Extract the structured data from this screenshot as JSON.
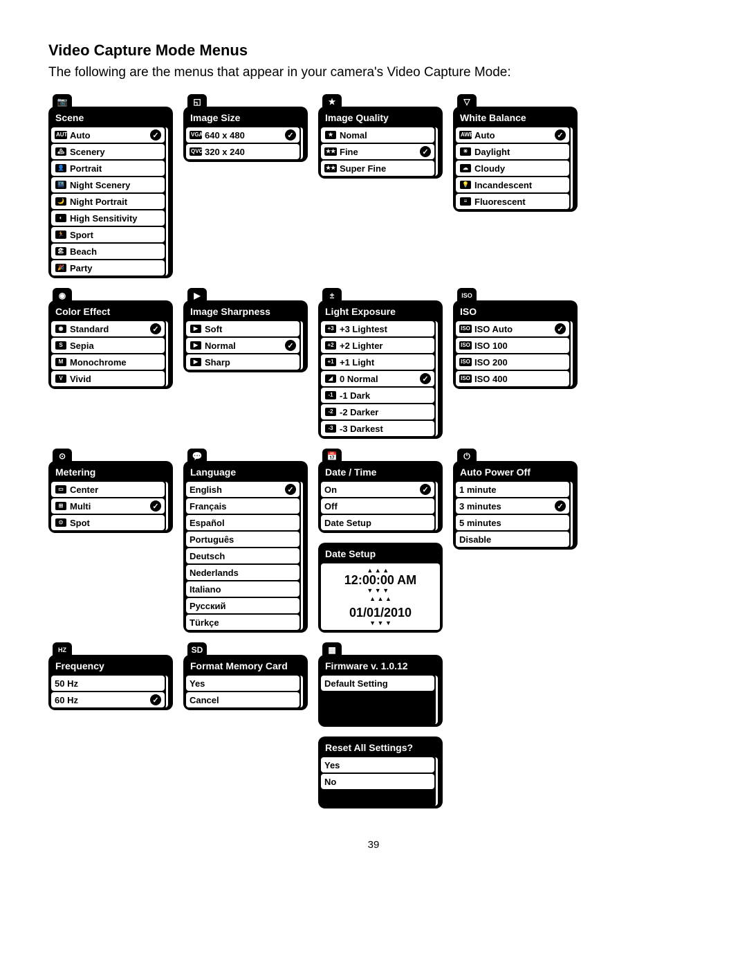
{
  "page_number": "39",
  "title": "Video Capture Mode Menus",
  "intro": "The following are the menus that appear in your camera's Video Capture Mode:",
  "menus": {
    "scene": {
      "title": "Scene",
      "items": [
        {
          "icon": "AUTO",
          "label": "Auto",
          "checked": true
        },
        {
          "icon": "🏔",
          "label": "Scenery"
        },
        {
          "icon": "👤",
          "label": "Portrait"
        },
        {
          "icon": "🌃",
          "label": "Night Scenery"
        },
        {
          "icon": "🌙",
          "label": "Night Portrait"
        },
        {
          "icon": "◐",
          "label": "High Sensitivity"
        },
        {
          "icon": "🏃",
          "label": "Sport"
        },
        {
          "icon": "🏖",
          "label": "Beach"
        },
        {
          "icon": "🎉",
          "label": "Party"
        }
      ]
    },
    "image_size": {
      "title": "Image Size",
      "items": [
        {
          "icon": "VGA",
          "label": "640 x 480",
          "checked": true
        },
        {
          "icon": "QVGA",
          "label": "320 x 240"
        }
      ]
    },
    "image_quality": {
      "title": "Image Quality",
      "items": [
        {
          "icon": "★",
          "label": "Nomal"
        },
        {
          "icon": "★★",
          "label": "Fine",
          "checked": true
        },
        {
          "icon": "★★",
          "label": "Super Fine"
        }
      ]
    },
    "white_balance": {
      "title": "White Balance",
      "items": [
        {
          "icon": "AWB",
          "label": "Auto",
          "checked": true
        },
        {
          "icon": "☀",
          "label": "Daylight"
        },
        {
          "icon": "☁",
          "label": "Cloudy"
        },
        {
          "icon": "💡",
          "label": "Incandescent"
        },
        {
          "icon": "≡",
          "label": "Fluorescent"
        }
      ]
    },
    "color_effect": {
      "title": "Color Effect",
      "items": [
        {
          "icon": "◉",
          "label": "Standard",
          "checked": true
        },
        {
          "icon": "S",
          "label": "Sepia"
        },
        {
          "icon": "M",
          "label": "Monochrome"
        },
        {
          "icon": "V",
          "label": "Vivid"
        }
      ]
    },
    "image_sharpness": {
      "title": "Image Sharpness",
      "items": [
        {
          "icon": "▶",
          "label": "Soft"
        },
        {
          "icon": "▶",
          "label": "Normal",
          "checked": true
        },
        {
          "icon": "▶",
          "label": "Sharp"
        }
      ]
    },
    "light_exposure": {
      "title": "Light Exposure",
      "items": [
        {
          "icon": "+3",
          "label": "+3 Lightest"
        },
        {
          "icon": "+2",
          "label": "+2 Lighter"
        },
        {
          "icon": "+1",
          "label": "+1 Light"
        },
        {
          "icon": "◢",
          "label": "0 Normal",
          "checked": true
        },
        {
          "icon": "-1",
          "label": "-1 Dark"
        },
        {
          "icon": "-2",
          "label": "-2 Darker"
        },
        {
          "icon": "-3",
          "label": "-3 Darkest"
        }
      ]
    },
    "iso": {
      "title": "ISO",
      "items": [
        {
          "icon": "ISO",
          "label": "ISO Auto",
          "checked": true
        },
        {
          "icon": "ISO",
          "label": "ISO 100"
        },
        {
          "icon": "ISO",
          "label": "ISO 200"
        },
        {
          "icon": "ISO",
          "label": "ISO 400"
        }
      ]
    },
    "metering": {
      "title": "Metering",
      "items": [
        {
          "icon": "▭",
          "label": "Center"
        },
        {
          "icon": "⊞",
          "label": "Multi",
          "checked": true
        },
        {
          "icon": "⊙",
          "label": "Spot"
        }
      ]
    },
    "language": {
      "title": "Language",
      "items": [
        {
          "label": "English",
          "checked": true
        },
        {
          "label": "Français"
        },
        {
          "label": "Español"
        },
        {
          "label": "Português"
        },
        {
          "label": "Deutsch"
        },
        {
          "label": "Nederlands"
        },
        {
          "label": "Italiano"
        },
        {
          "label": "Русский"
        },
        {
          "label": "Türkçe"
        }
      ]
    },
    "date_time": {
      "title": "Date / Time",
      "items": [
        {
          "label": "On",
          "checked": true
        },
        {
          "label": "Off"
        },
        {
          "label": "Date Setup"
        }
      ]
    },
    "date_setup": {
      "title": "Date Setup",
      "time": "12:00:00 AM",
      "date": "01/01/2010"
    },
    "auto_power_off": {
      "title": "Auto Power Off",
      "items": [
        {
          "label": "1 minute"
        },
        {
          "label": "3 minutes",
          "checked": true
        },
        {
          "label": "5 minutes"
        },
        {
          "label": "Disable"
        }
      ]
    },
    "frequency": {
      "title": "Frequency",
      "items": [
        {
          "label": "50 Hz"
        },
        {
          "label": "60 Hz",
          "checked": true
        }
      ]
    },
    "format": {
      "title": "Format Memory Card",
      "items": [
        {
          "label": "Yes"
        },
        {
          "label": "Cancel"
        }
      ]
    },
    "firmware": {
      "title": "Firmware v. 1.0.12",
      "items": [
        {
          "label": "Default Setting"
        }
      ]
    },
    "reset": {
      "title": "Reset All Settings?",
      "items": [
        {
          "label": "Yes"
        },
        {
          "label": "No"
        }
      ]
    }
  }
}
